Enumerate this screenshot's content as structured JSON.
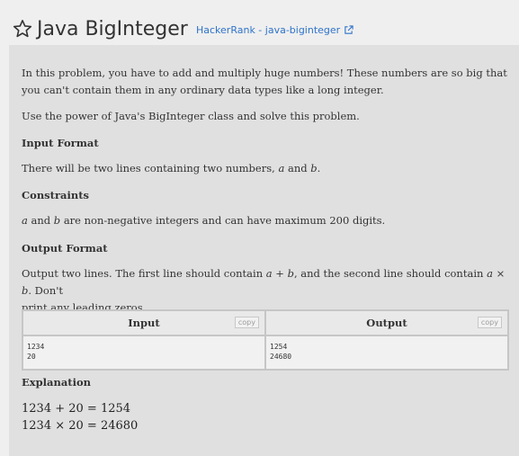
{
  "header": {
    "title": "Java BigInteger",
    "source_link": "HackerRank - java-biginteger"
  },
  "body": {
    "intro_p1": "In this problem, you have to add and multiply huge numbers! These numbers are so big that you can't contain them in any ordinary data types like a long integer.",
    "intro_p2": "Use the power of Java's BigInteger class and solve this problem.",
    "input_format_heading": "Input Format",
    "input_format_text_before": "There will be two lines containing two numbers, ",
    "input_var_a": "a",
    "input_and": " and ",
    "input_var_b": "b",
    "input_period": ".",
    "constraints_heading": "Constraints",
    "constraints_a": "a",
    "constraints_and": " and ",
    "constraints_b": "b",
    "constraints_text": " are non-negative integers and can have maximum ",
    "constraints_max": "200",
    "constraints_digits": " digits.",
    "output_format_heading": "Output Format",
    "output_line1_before": "Output two lines. The first line should contain ",
    "output_sum_expr": "a + b",
    "output_line1_mid": ", and the second line should contain ",
    "output_prod_expr": "a × b",
    "output_line1_end": ". Don't",
    "output_line2": "print any leading zeros."
  },
  "io_table": {
    "input_header": "Input",
    "output_header": "Output",
    "copy_label": "copy",
    "input_lines": "1234\n20",
    "output_lines": "1254\n24680"
  },
  "explanation": {
    "heading": "Explanation",
    "line1": "1234 + 20 = 1254",
    "line2": "1234 × 20 = 24680"
  }
}
